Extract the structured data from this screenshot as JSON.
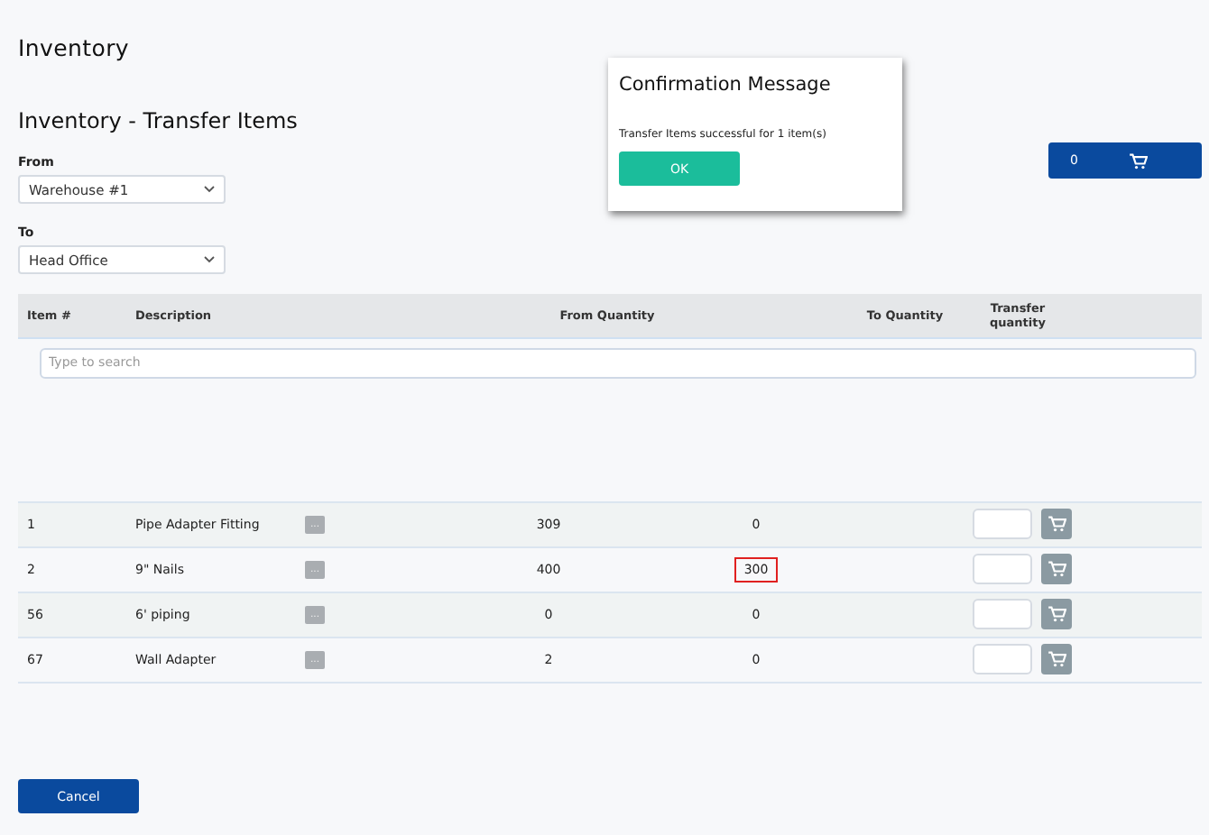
{
  "page_title": "Inventory",
  "form_title": "Inventory - Transfer Items",
  "from": {
    "label": "From",
    "value": "Warehouse #1"
  },
  "to": {
    "label": "To",
    "value": "Head Office"
  },
  "cart_button": {
    "count": "0"
  },
  "dialog": {
    "title": "Confirmation Message",
    "message": "Transfer Items successful for 1 item(s)",
    "button": "OK"
  },
  "table": {
    "columns": [
      "Item #",
      "Description",
      "From Quantity",
      "To Quantity",
      "Transfer quantity"
    ],
    "search": {
      "placeholder": "Type to search"
    },
    "rows": [
      {
        "item": "1",
        "description": "Pipe Adapter Fitting",
        "details": "...",
        "from_quantity": "309",
        "to_quantity": "0",
        "highlighted": false
      },
      {
        "item": "2",
        "description": "9\" Nails",
        "details": "...",
        "from_quantity": "400",
        "to_quantity": "300",
        "highlighted": true
      },
      {
        "item": "56",
        "description": "6' piping",
        "details": "...",
        "from_quantity": "0",
        "to_quantity": "0",
        "highlighted": false
      },
      {
        "item": "67",
        "description": "Wall Adapter",
        "details": "...",
        "from_quantity": "2",
        "to_quantity": "0",
        "highlighted": false
      }
    ]
  },
  "cancel_button": "Cancel"
}
